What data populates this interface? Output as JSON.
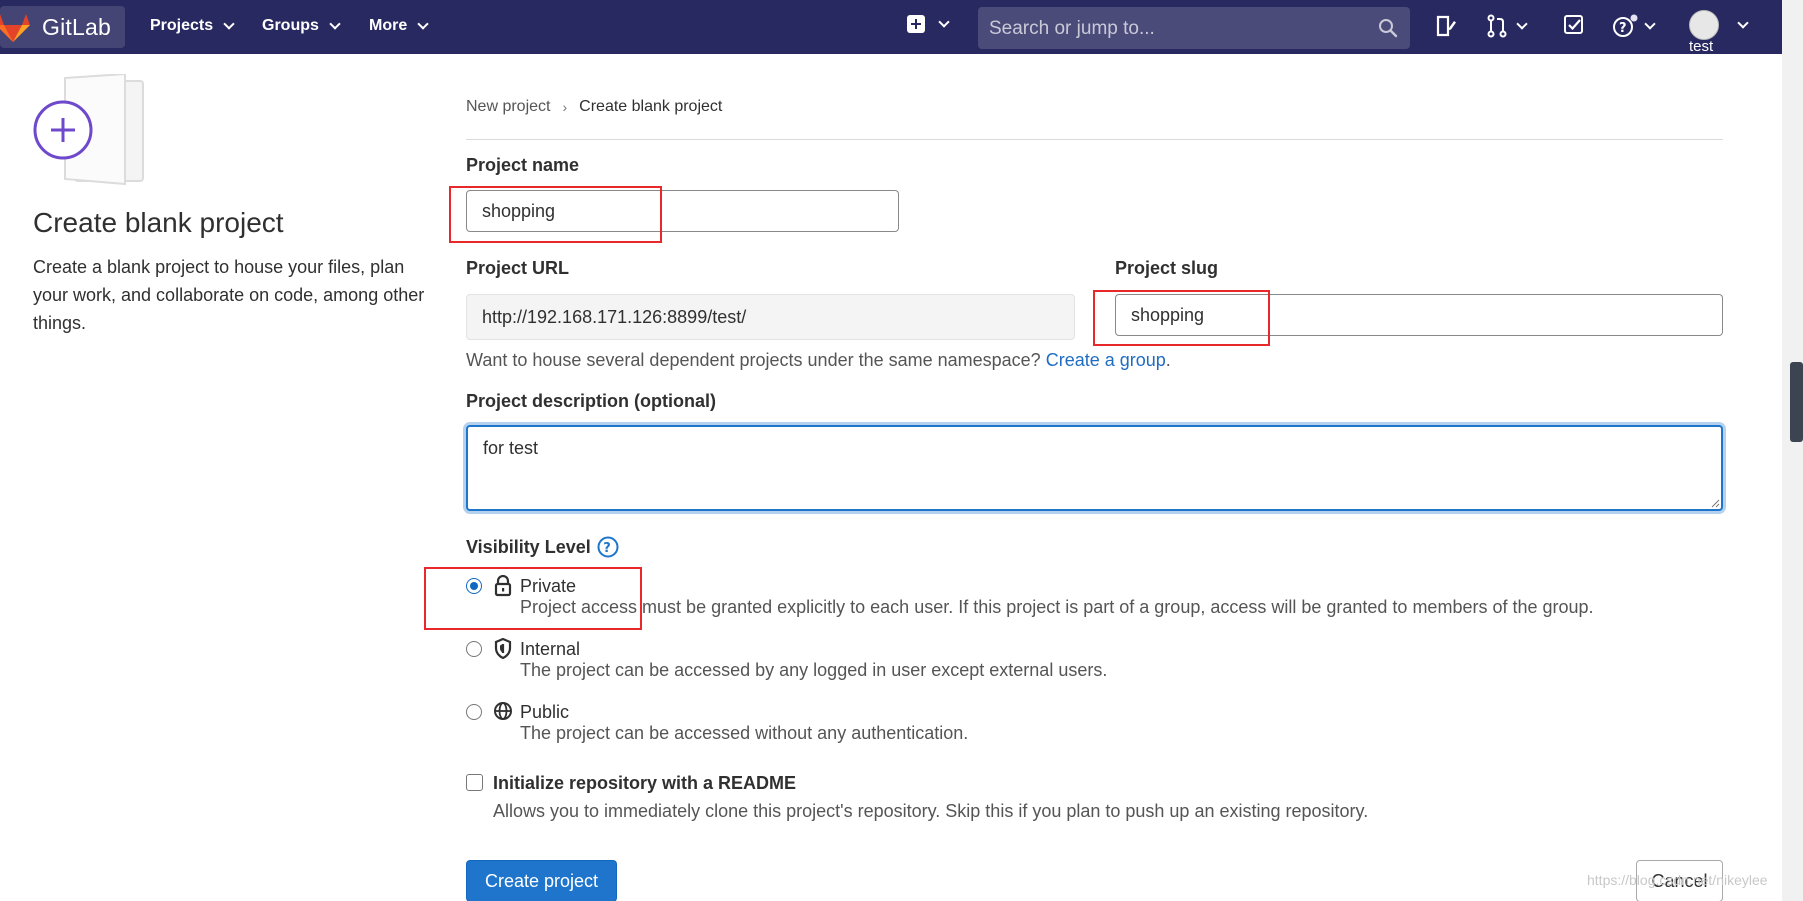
{
  "navbar": {
    "brand": "GitLab",
    "menu": [
      {
        "label": "Projects"
      },
      {
        "label": "Groups"
      },
      {
        "label": "More"
      }
    ],
    "search_placeholder": "Search or jump to...",
    "user": "test"
  },
  "left": {
    "title": "Create blank project",
    "description": "Create a blank project to house your files, plan your work, and collaborate on code, among other things."
  },
  "breadcrumb": {
    "parent": "New project",
    "current": "Create blank project"
  },
  "form": {
    "project_name_label": "Project name",
    "project_name_value": "shopping",
    "project_url_label": "Project URL",
    "project_url_value": "http://192.168.171.126:8899/test/",
    "project_slug_label": "Project slug",
    "project_slug_value": "shopping",
    "namespace_help": "Want to house several dependent projects under the same namespace?",
    "namespace_link": "Create a group",
    "description_label": "Project description (optional)",
    "description_value": "for test",
    "visibility_label": "Visibility Level",
    "visibility": [
      {
        "title": "Private",
        "desc": "Project access must be granted explicitly to each user. If this project is part of a group, access will be granted to members of the group.",
        "icon": "lock-icon",
        "selected": true
      },
      {
        "title": "Internal",
        "desc": "The project can be accessed by any logged in user except external users.",
        "icon": "shield-icon",
        "selected": false
      },
      {
        "title": "Public",
        "desc": "The project can be accessed without any authentication.",
        "icon": "globe-icon",
        "selected": false
      }
    ],
    "readme_label": "Initialize repository with a README",
    "readme_desc": "Allows you to immediately clone this project's repository. Skip this if you plan to push up an existing repository.",
    "create_button": "Create project",
    "cancel_button": "Cancel"
  },
  "colors": {
    "navbar_bg": "#292961",
    "primary": "#1f75cb",
    "link": "#1f6cc2",
    "annotation_red": "#e8282b"
  },
  "watermark": "https://blog.csdn.net/nikeylee"
}
